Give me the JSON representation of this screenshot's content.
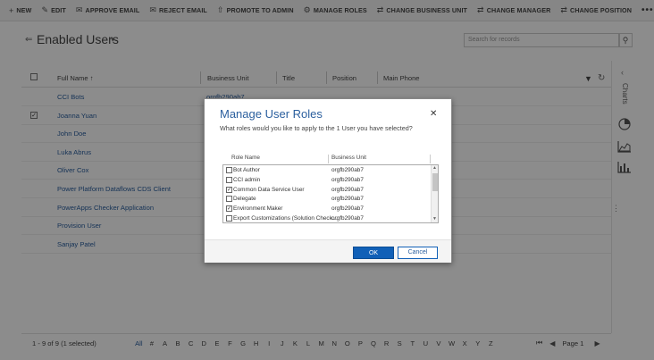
{
  "commandbar": {
    "items": [
      {
        "icon": "+",
        "label": "NEW"
      },
      {
        "icon": "✎",
        "label": "EDIT"
      },
      {
        "icon": "✉",
        "label": "APPROVE EMAIL"
      },
      {
        "icon": "✉",
        "label": "REJECT EMAIL"
      },
      {
        "icon": "⇧",
        "label": "PROMOTE TO ADMIN"
      },
      {
        "icon": "⚙",
        "label": "MANAGE ROLES"
      },
      {
        "icon": "⇄",
        "label": "CHANGE BUSINESS UNIT"
      },
      {
        "icon": "⇄",
        "label": "CHANGE MANAGER"
      },
      {
        "icon": "⇄",
        "label": "CHANGE POSITION"
      }
    ],
    "more": "•••"
  },
  "header": {
    "view_title": "Enabled Users",
    "search_placeholder": "Search for records"
  },
  "grid": {
    "columns": [
      "Full Name ↑",
      "Business Unit",
      "Title",
      "Position",
      "Main Phone"
    ],
    "rows": [
      {
        "name": "CCI Bots",
        "business_unit": "orgfb290ab7",
        "checked": false
      },
      {
        "name": "Joanna Yuan",
        "business_unit": "",
        "checked": true
      },
      {
        "name": "John Doe",
        "business_unit": "",
        "checked": false
      },
      {
        "name": "Luka Abrus",
        "business_unit": "",
        "checked": false
      },
      {
        "name": "Oliver Cox",
        "business_unit": "",
        "checked": false
      },
      {
        "name": "Power Platform Dataflows CDS Client",
        "business_unit": "",
        "checked": false
      },
      {
        "name": "PowerApps Checker Application",
        "business_unit": "",
        "checked": false
      },
      {
        "name": "Provision User",
        "business_unit": "",
        "checked": false
      },
      {
        "name": "Sanjay Patel",
        "business_unit": "",
        "checked": false
      }
    ]
  },
  "rightpane": {
    "charts_label": "Charts"
  },
  "footer": {
    "count": "1 - 9 of 9 (1 selected)",
    "alpha": [
      "All",
      "#",
      "A",
      "B",
      "C",
      "D",
      "E",
      "F",
      "G",
      "H",
      "I",
      "J",
      "K",
      "L",
      "M",
      "N",
      "O",
      "P",
      "Q",
      "R",
      "S",
      "T",
      "U",
      "V",
      "W",
      "X",
      "Y",
      "Z"
    ],
    "page_label": "Page 1"
  },
  "dialog": {
    "title": "Manage User Roles",
    "subtitle": "What roles would you like to apply to the 1 User you have selected?",
    "col_role": "Role Name",
    "col_bu": "Business Unit",
    "roles": [
      {
        "name": "Bot Author",
        "bu": "orgfb290ab7",
        "checked": false
      },
      {
        "name": "CCI admin",
        "bu": "orgfb290ab7",
        "checked": false
      },
      {
        "name": "Common Data Service User",
        "bu": "orgfb290ab7",
        "checked": true
      },
      {
        "name": "Delegate",
        "bu": "orgfb290ab7",
        "checked": false
      },
      {
        "name": "Environment Maker",
        "bu": "orgfb290ab7",
        "checked": true
      },
      {
        "name": "Export Customizations (Solution Check...",
        "bu": "orgfb290ab7",
        "checked": false
      }
    ],
    "ok_label": "OK",
    "cancel_label": "Cancel"
  }
}
